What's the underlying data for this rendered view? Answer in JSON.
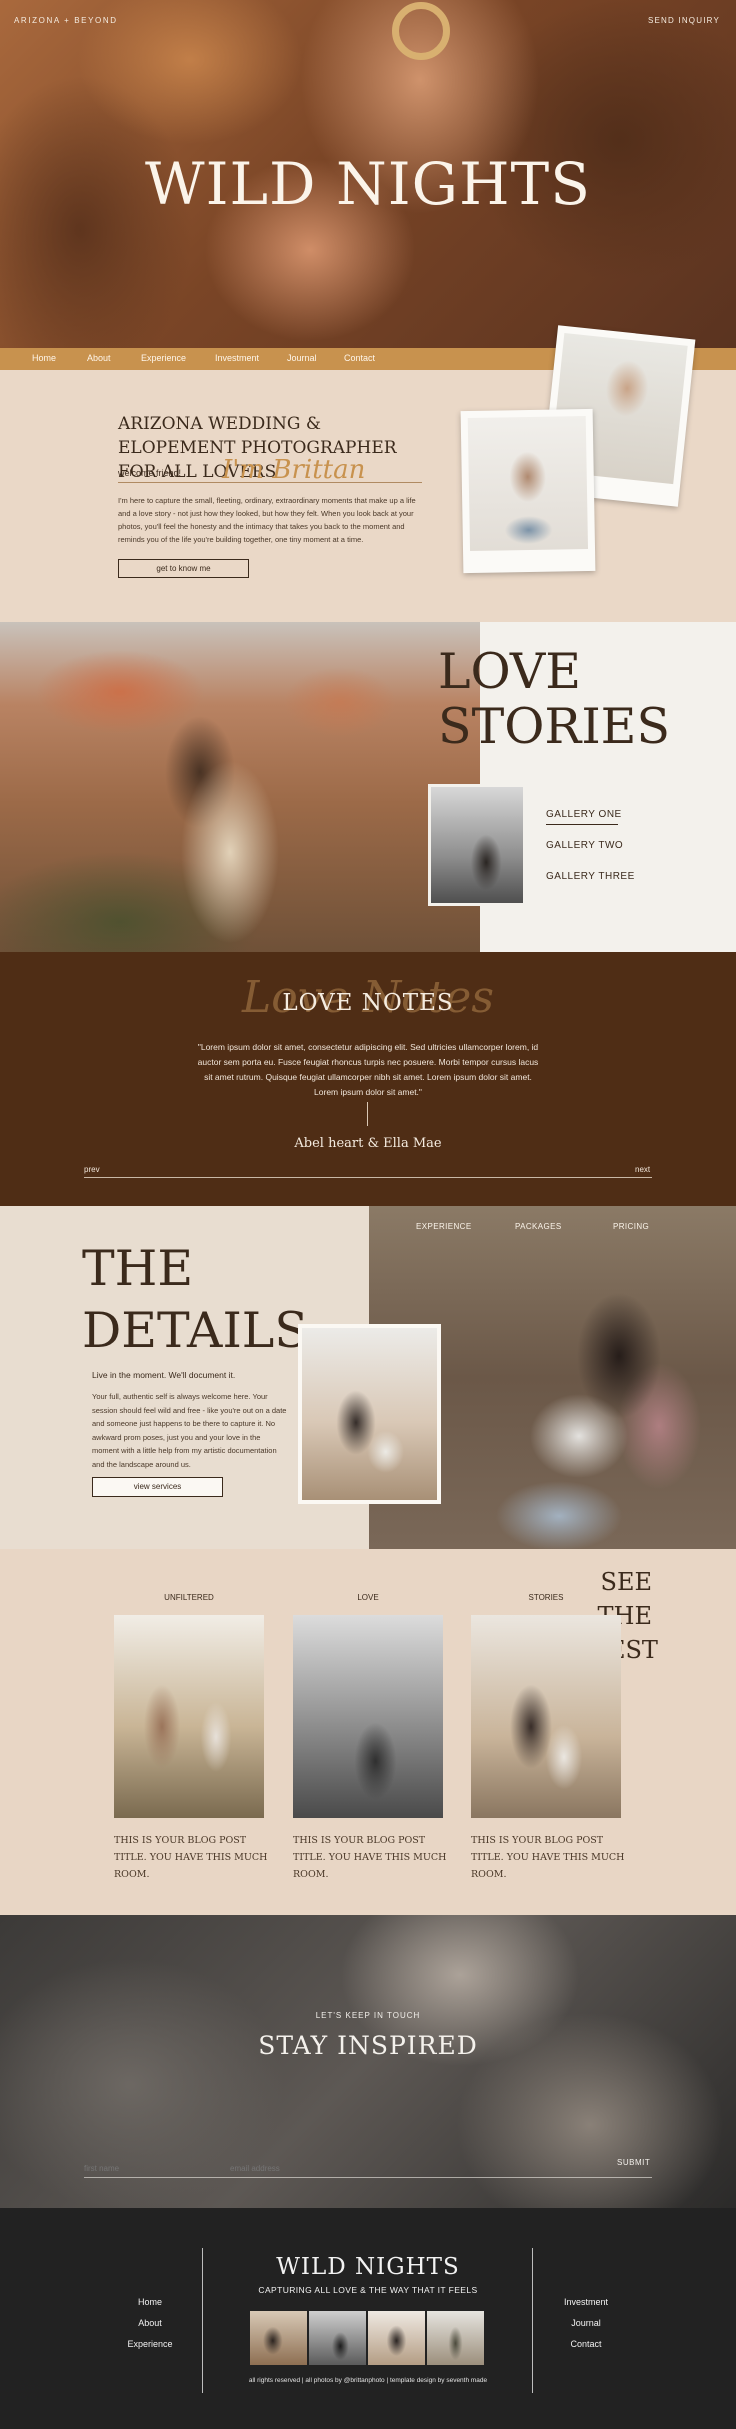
{
  "hero": {
    "brand": "ARIZONA + BEYOND",
    "inquiry": "SEND INQUIRY",
    "title": "WILD NIGHTS"
  },
  "nav": {
    "items": [
      {
        "label": "Home"
      },
      {
        "label": "About"
      },
      {
        "label": "Experience"
      },
      {
        "label": "Investment"
      },
      {
        "label": "Journal"
      },
      {
        "label": "Contact"
      }
    ]
  },
  "intro": {
    "title": "ARIZONA WEDDING & ELOPEMENT PHOTOGRAPHER FOR ALL LOVERS",
    "welcome": "welcome friend!",
    "signature": "I'm Brittan",
    "body": "I'm here to capture the small, fleeting, ordinary, extraordinary moments that make up a life and a love story - not just how they looked, but how they felt. When you look back at your photos, you'll feel the honesty and the intimacy that takes you back to the moment and reminds you of the life you're building together, one tiny moment at a time.",
    "button": "get to know me"
  },
  "stories": {
    "title_line1": "LOVE",
    "title_line2": "STORIES",
    "galleries": [
      {
        "label": "GALLERY ONE"
      },
      {
        "label": "GALLERY TWO"
      },
      {
        "label": "GALLERY THREE"
      }
    ]
  },
  "notes": {
    "script_word": "Love Notes",
    "title": "LOVE NOTES",
    "quote": "\"Lorem ipsum dolor sit amet, consectetur adipiscing elit. Sed ultricies ullamcorper lorem, id auctor sem porta eu. Fusce feugiat rhoncus turpis nec posuere. Morbi tempor cursus lacus sit amet rutrum. Quisque feugiat ullamcorper nibh sit amet. Lorem ipsum dolor sit amet. Lorem ipsum dolor sit amet.\"",
    "author": "Abel heart & Ella Mae",
    "prev": "prev",
    "next": "next"
  },
  "details": {
    "nav": [
      {
        "label": "EXPERIENCE"
      },
      {
        "label": "PACKAGES"
      },
      {
        "label": "PRICING"
      }
    ],
    "title_line1": "THE",
    "title_line2": "DETAILS",
    "subtitle": "Live in the moment. We'll document it.",
    "body": "Your full, authentic self is always welcome here. Your session should feel wild and free - like you're out on a date and someone just happens to be there to capture it. No awkward prom poses, just you and your love in the moment with a little help from my artistic documentation and the landscape around us.",
    "button": "view services"
  },
  "blog": {
    "latest_line1": "SEE",
    "latest_line2": "THE",
    "latest_line3": "LATEST",
    "posts": [
      {
        "category": "UNFILTERED",
        "title": "THIS IS YOUR BLOG POST TITLE. YOU HAVE THIS MUCH ROOM."
      },
      {
        "category": "LOVE",
        "title": "THIS IS YOUR BLOG POST TITLE. YOU HAVE THIS MUCH ROOM."
      },
      {
        "category": "STORIES",
        "title": "THIS IS YOUR BLOG POST TITLE. YOU HAVE THIS MUCH ROOM."
      }
    ]
  },
  "inspired": {
    "kicker": "LET'S KEEP IN TOUCH",
    "title": "STAY INSPIRED",
    "name_placeholder": "first name",
    "email_placeholder": "email address",
    "submit": "SUBMIT"
  },
  "footer": {
    "left_links": [
      {
        "label": "Home"
      },
      {
        "label": "About"
      },
      {
        "label": "Experience"
      }
    ],
    "right_links": [
      {
        "label": "Investment"
      },
      {
        "label": "Journal"
      },
      {
        "label": "Contact"
      }
    ],
    "title": "WILD NIGHTS",
    "tagline": "CAPTURING ALL LOVE & THE WAY THAT IT FEELS",
    "copyright": "all rights reserved | all photos by @brittanphoto | template design by seventh made"
  },
  "colors": {
    "accent_gold": "#c8924e",
    "dark_brown": "#4f2d15",
    "cream": "#ead8c7",
    "footer_bg": "#222222"
  }
}
